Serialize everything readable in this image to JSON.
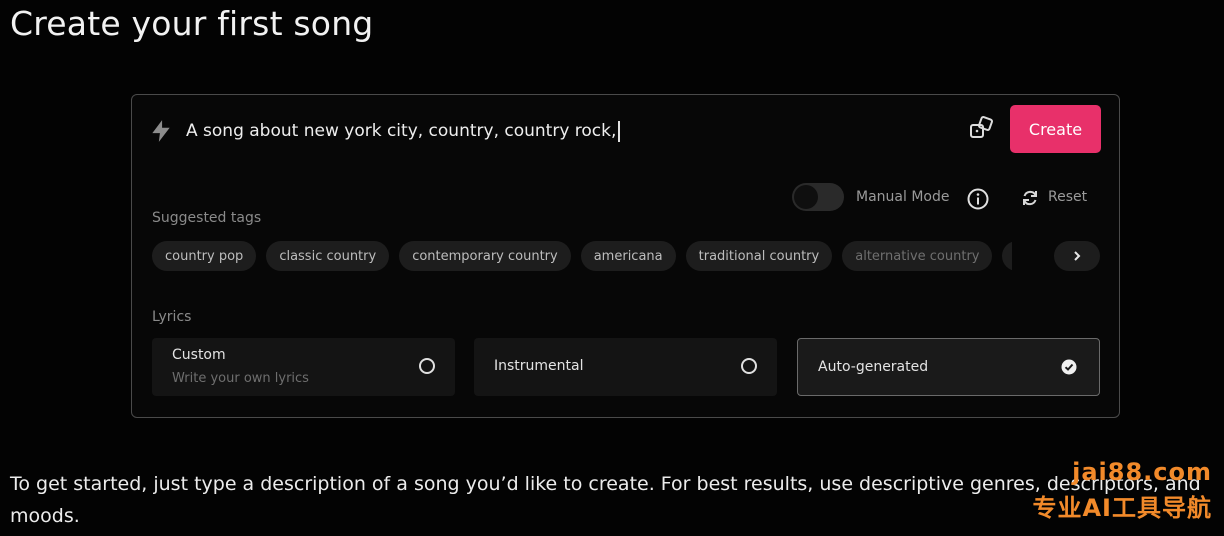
{
  "page": {
    "title": "Create your first song",
    "help_text": "To get started, just type a description of a song you’d like to create. For best results, use descriptive genres, descriptors, and moods."
  },
  "prompt": {
    "value": "A song about new york city, country, country rock,",
    "create_label": "Create"
  },
  "controls": {
    "manual_mode_label": "Manual Mode",
    "manual_mode_on": false,
    "reset_label": "Reset"
  },
  "suggested_tags": {
    "label": "Suggested tags",
    "items": [
      "country pop",
      "classic country",
      "contemporary country",
      "americana",
      "traditional country",
      "alternative country",
      "tr"
    ]
  },
  "lyrics": {
    "label": "Lyrics",
    "options": [
      {
        "title": "Custom",
        "subtitle": "Write your own lyrics",
        "selected": false
      },
      {
        "title": "Instrumental",
        "selected": false
      },
      {
        "title": "Auto-generated",
        "selected": true
      }
    ]
  },
  "watermark": {
    "url": "jai88.com",
    "tagline": "专业AI工具导航"
  },
  "colors": {
    "accent": "#e8306a",
    "background": "#030303",
    "watermark": "#f28a2a"
  }
}
